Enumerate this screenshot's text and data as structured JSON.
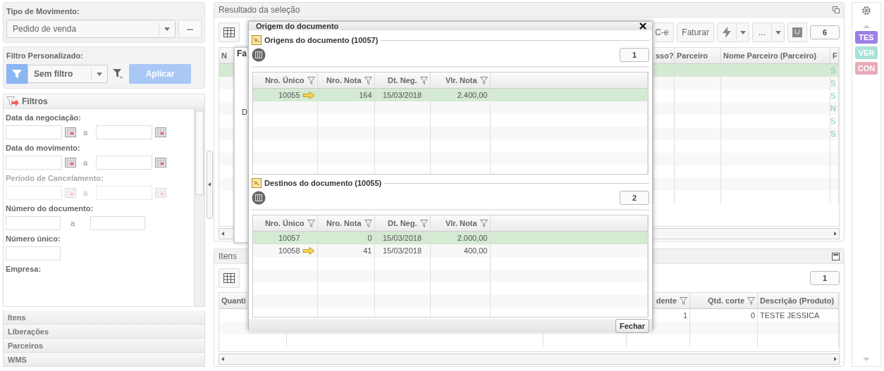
{
  "movement_type": {
    "label": "Tipo de Movimento:",
    "value": "Pedido de venda",
    "more_button": "•••"
  },
  "custom_filter": {
    "label": "Filtro Personalizado:",
    "value": "Sem filtro",
    "apply_button": "Aplicar"
  },
  "filters_panel": {
    "title": "Filtros",
    "fields": [
      {
        "label": "Data da negociação:",
        "kind": "date_range",
        "separator": "a",
        "disabled": false
      },
      {
        "label": "Data do movimento:",
        "kind": "date_range",
        "separator": "a",
        "disabled": false
      },
      {
        "label": "Período de Cancelamento:",
        "kind": "date_range",
        "separator": "a",
        "disabled": true
      },
      {
        "label": "Número do documento:",
        "kind": "number_range",
        "separator": "a",
        "disabled": false
      },
      {
        "label": "Número único:",
        "kind": "single",
        "disabled": false
      },
      {
        "label": "Empresa:",
        "kind": "label_only",
        "disabled": false
      }
    ]
  },
  "accordion": [
    {
      "label": "Itens"
    },
    {
      "label": "Liberações"
    },
    {
      "label": "Parceiros"
    },
    {
      "label": "WMS"
    }
  ],
  "results": {
    "title": "Resultado da seleção",
    "toolbar": {
      "partial_button": "C-e",
      "invoice_button": "Faturar",
      "more_button": "...",
      "page_badge": "6"
    },
    "background_window": {
      "tab": "Fa",
      "text": "D"
    },
    "columns": [
      "N",
      "sso?",
      "Parceiro",
      "Nome Parceiro (Parceiro)",
      "F"
    ],
    "rows": [
      {
        "selected": true,
        "column_5": "S"
      },
      {
        "selected": false,
        "column_5": "S"
      },
      {
        "selected": false,
        "column_5": "S"
      },
      {
        "selected": false,
        "column_5": "N"
      },
      {
        "selected": false,
        "column_5": "S"
      },
      {
        "selected": false,
        "column_5": "S"
      }
    ]
  },
  "items": {
    "title": "Itens",
    "page_badge": "1",
    "columns": [
      "Quanti",
      "dente",
      "Qtd. corte",
      "Descrição (Produto)"
    ],
    "rows": [
      {
        "pending": "1",
        "cut": "0",
        "description": "TESTE JESSICA"
      }
    ]
  },
  "tags": [
    {
      "label": "TES",
      "color": "#9c80e6"
    },
    {
      "label": "VER",
      "color": "#a9e1d8"
    },
    {
      "label": "CON",
      "color": "#e9a9b9"
    }
  ],
  "dialog": {
    "title": "Origem do documento",
    "close_button": "Fechar",
    "sections": [
      {
        "title": "Origens do documento (10057)",
        "badge": "1",
        "columns": [
          "Nro. Único",
          "Nro. Nota",
          "Dt. Neg.",
          "Vlr. Nota"
        ],
        "rows": [
          {
            "unique": "10055",
            "arrow": true,
            "note": "164",
            "date": "15/03/2018",
            "value": "2.400,00",
            "selected": true
          }
        ]
      },
      {
        "title": "Destinos do documento (10055)",
        "badge": "2",
        "columns": [
          "Nro. Único",
          "Nro. Nota",
          "Dt. Neg.",
          "Vlr. Nota"
        ],
        "rows": [
          {
            "unique": "10057",
            "arrow": false,
            "note": "0",
            "date": "15/03/2018",
            "value": "2.000,00",
            "selected": true
          },
          {
            "unique": "10058",
            "arrow": true,
            "note": "41",
            "date": "15/03/2018",
            "value": "400,00",
            "selected": false
          }
        ]
      }
    ]
  }
}
